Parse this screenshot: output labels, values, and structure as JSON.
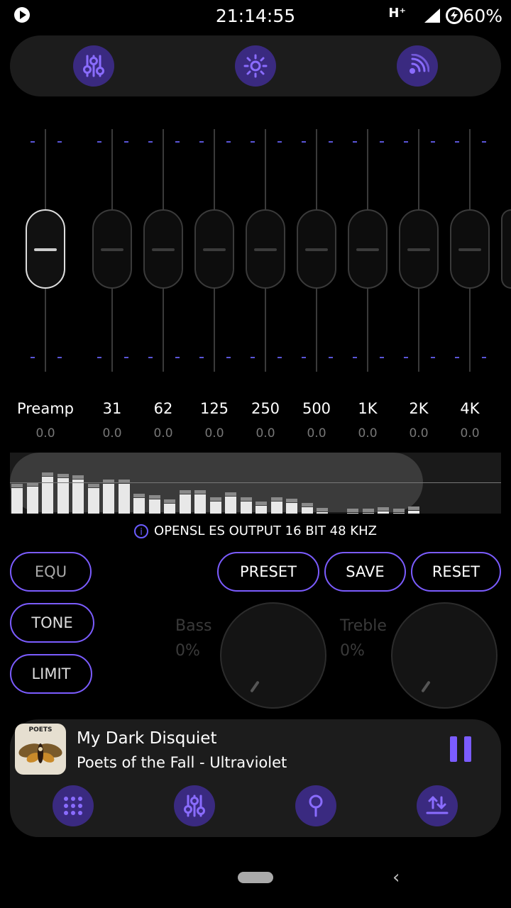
{
  "status_bar": {
    "time": "21:14:55",
    "network": "H⁺",
    "battery": "60%"
  },
  "top_tabs": [
    {
      "icon": "equalizer-sliders-icon"
    },
    {
      "icon": "sun-effects-icon"
    },
    {
      "icon": "surround-speaker-icon"
    }
  ],
  "bands": [
    {
      "label": "Preamp",
      "value": "0.0"
    },
    {
      "label": "31",
      "value": "0.0"
    },
    {
      "label": "62",
      "value": "0.0"
    },
    {
      "label": "125",
      "value": "0.0"
    },
    {
      "label": "250",
      "value": "0.0"
    },
    {
      "label": "500",
      "value": "0.0"
    },
    {
      "label": "1K",
      "value": "0.0"
    },
    {
      "label": "2K",
      "value": "0.0"
    },
    {
      "label": "4K",
      "value": "0.0"
    }
  ],
  "output_info": "OPENSL ES OUTPUT  16 BIT  48 KHZ",
  "mode_buttons": {
    "equ": "EQU",
    "tone": "TONE",
    "limit": "LIMIT"
  },
  "action_buttons": {
    "preset": "PRESET",
    "save": "SAVE",
    "reset": "RESET"
  },
  "tone": {
    "bass": {
      "label": "Bass",
      "value": "0%"
    },
    "treble": {
      "label": "Treble",
      "value": "0%"
    }
  },
  "player": {
    "title": "My Dark Disquiet",
    "artist": "Poets of the Fall - Ultraviolet",
    "cover_text": "POETS",
    "bottom_icons": [
      "grid-apps-icon",
      "equalizer-sliders-icon",
      "search-key-icon",
      "import-export-icon"
    ]
  },
  "colors": {
    "accent": "#7b5cff",
    "accent_dark": "#3a2a80",
    "panel": "#1c1c1c"
  }
}
